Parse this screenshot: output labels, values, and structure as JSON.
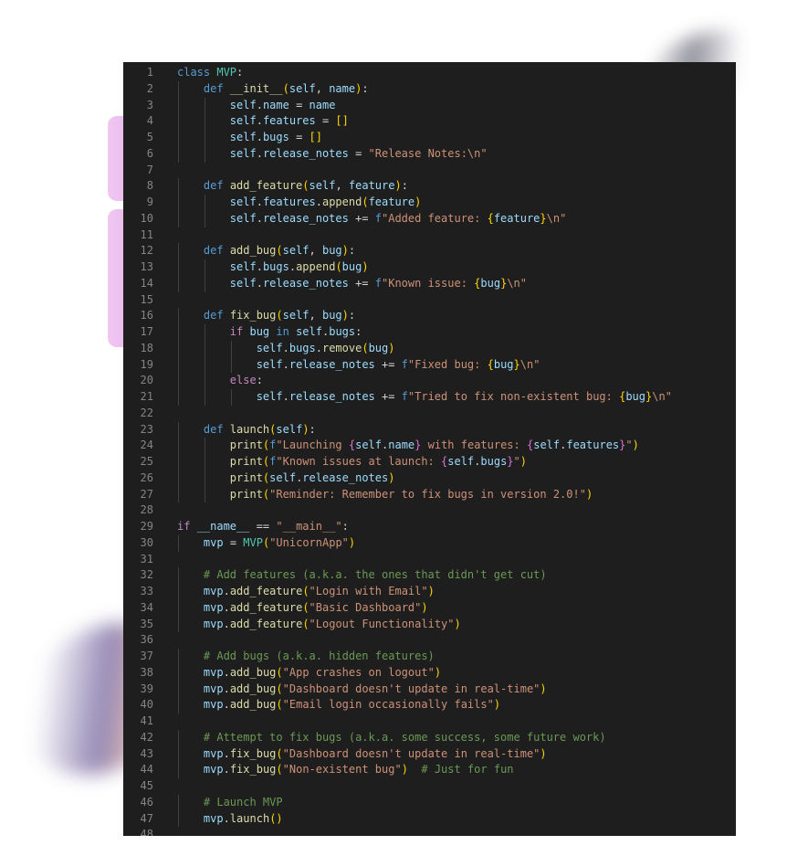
{
  "editor": {
    "language": "python",
    "lines": [
      [
        [
          "class ",
          "kw"
        ],
        [
          "MVP",
          "cls"
        ],
        [
          ":",
          "op"
        ]
      ],
      [
        [
          "    "
        ],
        [
          "def ",
          "kw"
        ],
        [
          "__init__",
          "fn"
        ],
        [
          "(",
          "br1"
        ],
        [
          "self",
          "var"
        ],
        [
          ", ",
          "op"
        ],
        [
          "name",
          "var"
        ],
        [
          ")",
          "br1"
        ],
        [
          ":",
          "op"
        ]
      ],
      [
        [
          "        "
        ],
        [
          "self",
          "var"
        ],
        [
          ".",
          "op"
        ],
        [
          "name",
          "var"
        ],
        [
          " = ",
          "op"
        ],
        [
          "name",
          "var"
        ]
      ],
      [
        [
          "        "
        ],
        [
          "self",
          "var"
        ],
        [
          ".",
          "op"
        ],
        [
          "features",
          "var"
        ],
        [
          " = ",
          "op"
        ],
        [
          "[]",
          "br1"
        ]
      ],
      [
        [
          "        "
        ],
        [
          "self",
          "var"
        ],
        [
          ".",
          "op"
        ],
        [
          "bugs",
          "var"
        ],
        [
          " = ",
          "op"
        ],
        [
          "[]",
          "br1"
        ]
      ],
      [
        [
          "        "
        ],
        [
          "self",
          "var"
        ],
        [
          ".",
          "op"
        ],
        [
          "release_notes",
          "var"
        ],
        [
          " = ",
          "op"
        ],
        [
          "\"Release Notes:\\n\"",
          "str"
        ]
      ],
      [],
      [
        [
          "    "
        ],
        [
          "def ",
          "kw"
        ],
        [
          "add_feature",
          "fn"
        ],
        [
          "(",
          "br1"
        ],
        [
          "self",
          "var"
        ],
        [
          ", ",
          "op"
        ],
        [
          "feature",
          "var"
        ],
        [
          ")",
          "br1"
        ],
        [
          ":",
          "op"
        ]
      ],
      [
        [
          "        "
        ],
        [
          "self",
          "var"
        ],
        [
          ".",
          "op"
        ],
        [
          "features",
          "var"
        ],
        [
          ".",
          "op"
        ],
        [
          "append",
          "fn"
        ],
        [
          "(",
          "br1"
        ],
        [
          "feature",
          "var"
        ],
        [
          ")",
          "br1"
        ]
      ],
      [
        [
          "        "
        ],
        [
          "self",
          "var"
        ],
        [
          ".",
          "op"
        ],
        [
          "release_notes",
          "var"
        ],
        [
          " += ",
          "op"
        ],
        [
          "f",
          "kw"
        ],
        [
          "\"Added feature: ",
          "str"
        ],
        [
          "{",
          "br1"
        ],
        [
          "feature",
          "var"
        ],
        [
          "}",
          "br1"
        ],
        [
          "\\n\"",
          "str"
        ]
      ],
      [],
      [
        [
          "    "
        ],
        [
          "def ",
          "kw"
        ],
        [
          "add_bug",
          "fn"
        ],
        [
          "(",
          "br1"
        ],
        [
          "self",
          "var"
        ],
        [
          ", ",
          "op"
        ],
        [
          "bug",
          "var"
        ],
        [
          ")",
          "br1"
        ],
        [
          ":",
          "op"
        ]
      ],
      [
        [
          "        "
        ],
        [
          "self",
          "var"
        ],
        [
          ".",
          "op"
        ],
        [
          "bugs",
          "var"
        ],
        [
          ".",
          "op"
        ],
        [
          "append",
          "fn"
        ],
        [
          "(",
          "br1"
        ],
        [
          "bug",
          "var"
        ],
        [
          ")",
          "br1"
        ]
      ],
      [
        [
          "        "
        ],
        [
          "self",
          "var"
        ],
        [
          ".",
          "op"
        ],
        [
          "release_notes",
          "var"
        ],
        [
          " += ",
          "op"
        ],
        [
          "f",
          "kw"
        ],
        [
          "\"Known issue: ",
          "str"
        ],
        [
          "{",
          "br1"
        ],
        [
          "bug",
          "var"
        ],
        [
          "}",
          "br1"
        ],
        [
          "\\n\"",
          "str"
        ]
      ],
      [],
      [
        [
          "    "
        ],
        [
          "def ",
          "kw"
        ],
        [
          "fix_bug",
          "fn"
        ],
        [
          "(",
          "br1"
        ],
        [
          "self",
          "var"
        ],
        [
          ", ",
          "op"
        ],
        [
          "bug",
          "var"
        ],
        [
          ")",
          "br1"
        ],
        [
          ":",
          "op"
        ]
      ],
      [
        [
          "        "
        ],
        [
          "if ",
          "kw2"
        ],
        [
          "bug",
          "var"
        ],
        [
          " in ",
          "kw"
        ],
        [
          "self",
          "var"
        ],
        [
          ".",
          "op"
        ],
        [
          "bugs",
          "var"
        ],
        [
          ":",
          "op"
        ]
      ],
      [
        [
          "            "
        ],
        [
          "self",
          "var"
        ],
        [
          ".",
          "op"
        ],
        [
          "bugs",
          "var"
        ],
        [
          ".",
          "op"
        ],
        [
          "remove",
          "fn"
        ],
        [
          "(",
          "br1"
        ],
        [
          "bug",
          "var"
        ],
        [
          ")",
          "br1"
        ]
      ],
      [
        [
          "            "
        ],
        [
          "self",
          "var"
        ],
        [
          ".",
          "op"
        ],
        [
          "release_notes",
          "var"
        ],
        [
          " += ",
          "op"
        ],
        [
          "f",
          "kw"
        ],
        [
          "\"Fixed bug: ",
          "str"
        ],
        [
          "{",
          "br1"
        ],
        [
          "bug",
          "var"
        ],
        [
          "}",
          "br1"
        ],
        [
          "\\n\"",
          "str"
        ]
      ],
      [
        [
          "        "
        ],
        [
          "else",
          "kw2"
        ],
        [
          ":",
          "op"
        ]
      ],
      [
        [
          "            "
        ],
        [
          "self",
          "var"
        ],
        [
          ".",
          "op"
        ],
        [
          "release_notes",
          "var"
        ],
        [
          " += ",
          "op"
        ],
        [
          "f",
          "kw"
        ],
        [
          "\"Tried to fix non-existent bug: ",
          "str"
        ],
        [
          "{",
          "br1"
        ],
        [
          "bug",
          "var"
        ],
        [
          "}",
          "br1"
        ],
        [
          "\\n\"",
          "str"
        ]
      ],
      [],
      [
        [
          "    "
        ],
        [
          "def ",
          "kw"
        ],
        [
          "launch",
          "fn"
        ],
        [
          "(",
          "br1"
        ],
        [
          "self",
          "var"
        ],
        [
          ")",
          "br1"
        ],
        [
          ":",
          "op"
        ]
      ],
      [
        [
          "        "
        ],
        [
          "print",
          "fn"
        ],
        [
          "(",
          "br1"
        ],
        [
          "f",
          "kw"
        ],
        [
          "\"Launching ",
          "str"
        ],
        [
          "{",
          "br2"
        ],
        [
          "self",
          "var"
        ],
        [
          ".",
          "op"
        ],
        [
          "name",
          "var"
        ],
        [
          "}",
          "br2"
        ],
        [
          " with features: ",
          "str"
        ],
        [
          "{",
          "br2"
        ],
        [
          "self",
          "var"
        ],
        [
          ".",
          "op"
        ],
        [
          "features",
          "var"
        ],
        [
          "}",
          "br2"
        ],
        [
          "\"",
          "str"
        ],
        [
          ")",
          "br1"
        ]
      ],
      [
        [
          "        "
        ],
        [
          "print",
          "fn"
        ],
        [
          "(",
          "br1"
        ],
        [
          "f",
          "kw"
        ],
        [
          "\"Known issues at launch: ",
          "str"
        ],
        [
          "{",
          "br2"
        ],
        [
          "self",
          "var"
        ],
        [
          ".",
          "op"
        ],
        [
          "bugs",
          "var"
        ],
        [
          "}",
          "br2"
        ],
        [
          "\"",
          "str"
        ],
        [
          ")",
          "br1"
        ]
      ],
      [
        [
          "        "
        ],
        [
          "print",
          "fn"
        ],
        [
          "(",
          "br1"
        ],
        [
          "self",
          "var"
        ],
        [
          ".",
          "op"
        ],
        [
          "release_notes",
          "var"
        ],
        [
          ")",
          "br1"
        ]
      ],
      [
        [
          "        "
        ],
        [
          "print",
          "fn"
        ],
        [
          "(",
          "br1"
        ],
        [
          "\"Reminder: Remember to fix bugs in version 2.0!\"",
          "str"
        ],
        [
          ")",
          "br1"
        ]
      ],
      [],
      [
        [
          "if ",
          "kw2"
        ],
        [
          "__name__",
          "var"
        ],
        [
          " == ",
          "op"
        ],
        [
          "\"__main__\"",
          "str"
        ],
        [
          ":",
          "op"
        ]
      ],
      [
        [
          "    "
        ],
        [
          "mvp",
          "var"
        ],
        [
          " = ",
          "op"
        ],
        [
          "MVP",
          "cls"
        ],
        [
          "(",
          "br1"
        ],
        [
          "\"UnicornApp\"",
          "str"
        ],
        [
          ")",
          "br1"
        ]
      ],
      [],
      [
        [
          "    "
        ],
        [
          "# Add features (a.k.a. the ones that didn't get cut)",
          "cmt"
        ]
      ],
      [
        [
          "    "
        ],
        [
          "mvp",
          "var"
        ],
        [
          ".",
          "op"
        ],
        [
          "add_feature",
          "fn"
        ],
        [
          "(",
          "br1"
        ],
        [
          "\"Login with Email\"",
          "str"
        ],
        [
          ")",
          "br1"
        ]
      ],
      [
        [
          "    "
        ],
        [
          "mvp",
          "var"
        ],
        [
          ".",
          "op"
        ],
        [
          "add_feature",
          "fn"
        ],
        [
          "(",
          "br1"
        ],
        [
          "\"Basic Dashboard\"",
          "str"
        ],
        [
          ")",
          "br1"
        ]
      ],
      [
        [
          "    "
        ],
        [
          "mvp",
          "var"
        ],
        [
          ".",
          "op"
        ],
        [
          "add_feature",
          "fn"
        ],
        [
          "(",
          "br1"
        ],
        [
          "\"Logout Functionality\"",
          "str"
        ],
        [
          ")",
          "br1"
        ]
      ],
      [],
      [
        [
          "    "
        ],
        [
          "# Add bugs (a.k.a. hidden features)",
          "cmt"
        ]
      ],
      [
        [
          "    "
        ],
        [
          "mvp",
          "var"
        ],
        [
          ".",
          "op"
        ],
        [
          "add_bug",
          "fn"
        ],
        [
          "(",
          "br1"
        ],
        [
          "\"App crashes on logout\"",
          "str"
        ],
        [
          ")",
          "br1"
        ]
      ],
      [
        [
          "    "
        ],
        [
          "mvp",
          "var"
        ],
        [
          ".",
          "op"
        ],
        [
          "add_bug",
          "fn"
        ],
        [
          "(",
          "br1"
        ],
        [
          "\"Dashboard doesn't update in real-time\"",
          "str"
        ],
        [
          ")",
          "br1"
        ]
      ],
      [
        [
          "    "
        ],
        [
          "mvp",
          "var"
        ],
        [
          ".",
          "op"
        ],
        [
          "add_bug",
          "fn"
        ],
        [
          "(",
          "br1"
        ],
        [
          "\"Email login occasionally fails\"",
          "str"
        ],
        [
          ")",
          "br1"
        ]
      ],
      [],
      [
        [
          "    "
        ],
        [
          "# Attempt to fix bugs (a.k.a. some success, some future work)",
          "cmt"
        ]
      ],
      [
        [
          "    "
        ],
        [
          "mvp",
          "var"
        ],
        [
          ".",
          "op"
        ],
        [
          "fix_bug",
          "fn"
        ],
        [
          "(",
          "br1"
        ],
        [
          "\"Dashboard doesn't update in real-time\"",
          "str"
        ],
        [
          ")",
          "br1"
        ]
      ],
      [
        [
          "    "
        ],
        [
          "mvp",
          "var"
        ],
        [
          ".",
          "op"
        ],
        [
          "fix_bug",
          "fn"
        ],
        [
          "(",
          "br1"
        ],
        [
          "\"Non-existent bug\"",
          "str"
        ],
        [
          ")",
          "br1"
        ],
        [
          "  "
        ],
        [
          "# Just for fun",
          "cmt"
        ]
      ],
      [],
      [
        [
          "    "
        ],
        [
          "# Launch MVP",
          "cmt"
        ]
      ],
      [
        [
          "    "
        ],
        [
          "mvp",
          "var"
        ],
        [
          ".",
          "op"
        ],
        [
          "launch",
          "fn"
        ],
        [
          "(",
          "br1"
        ],
        [
          ")",
          "br1"
        ]
      ],
      []
    ]
  }
}
